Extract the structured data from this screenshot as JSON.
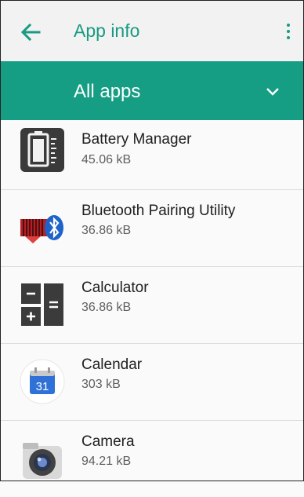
{
  "toolbar": {
    "title": "App info",
    "back_icon": "arrow-left-icon",
    "menu_icon": "more-vert-icon"
  },
  "filter": {
    "label": "All apps",
    "icon": "chevron-down-icon"
  },
  "apps": [
    {
      "name": "Battery Manager",
      "size": "45.06 kB",
      "icon": "battery-manager-icon"
    },
    {
      "name": "Bluetooth Pairing Utility",
      "size": "36.86 kB",
      "icon": "bluetooth-pairing-icon"
    },
    {
      "name": "Calculator",
      "size": "36.86 kB",
      "icon": "calculator-icon"
    },
    {
      "name": "Calendar",
      "size": "303 kB",
      "icon": "calendar-icon",
      "calendar_day": "31"
    },
    {
      "name": "Camera",
      "size": "94.21 kB",
      "icon": "camera-icon"
    }
  ],
  "colors": {
    "accent": "#1a9a82",
    "filter_bar": "#169e84"
  }
}
